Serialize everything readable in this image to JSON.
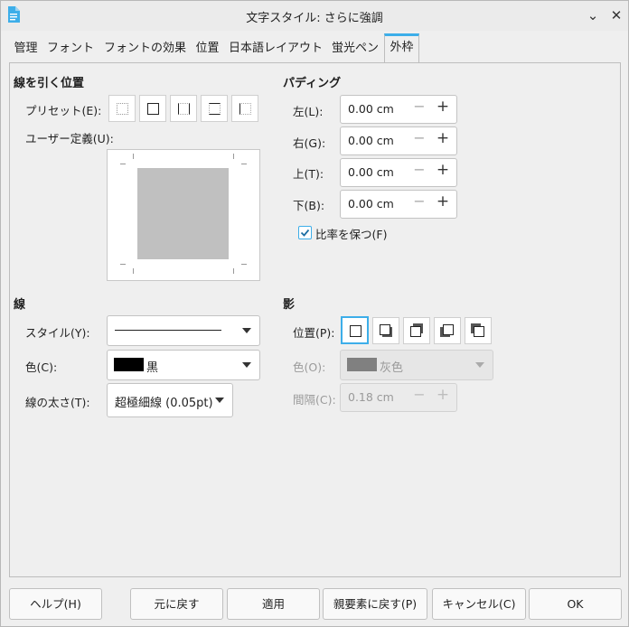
{
  "window": {
    "title": "文字スタイル: さらに強調"
  },
  "tabs": [
    "管理",
    "フォント",
    "フォントの効果",
    "位置",
    "日本語レイアウト",
    "蛍光ペン",
    "外枠"
  ],
  "borders": {
    "section_title": "線を引く位置",
    "preset_label": "プリセット(E):",
    "userdef_label": "ユーザー定義(U):"
  },
  "padding": {
    "section_title": "パディング",
    "left": {
      "label": "左(L):",
      "value": "0.00 cm"
    },
    "right": {
      "label": "右(G):",
      "value": "0.00 cm"
    },
    "top": {
      "label": "上(T):",
      "value": "0.00 cm"
    },
    "bottom": {
      "label": "下(B):",
      "value": "0.00 cm"
    },
    "keep_ratio": "比率を保つ(F)"
  },
  "line": {
    "section_title": "線",
    "style_label": "スタイル(Y):",
    "color_label": "色(C):",
    "color_value": "黒",
    "width_label": "線の太さ(T):",
    "width_value": "超極細線 (0.05pt)"
  },
  "shadow": {
    "section_title": "影",
    "position_label": "位置(P):",
    "color_label": "色(O):",
    "color_value": "灰色",
    "distance_label": "間隔(C):",
    "distance_value": "0.18 cm"
  },
  "buttons": {
    "help": "ヘルプ(H)",
    "reset": "元に戻す",
    "apply": "適用",
    "parent": "親要素に戻す(P)",
    "cancel": "キャンセル(C)",
    "ok": "OK"
  },
  "colors": {
    "accent": "#3daee9",
    "line_color": "#000000",
    "shadow_color": "#808080"
  }
}
